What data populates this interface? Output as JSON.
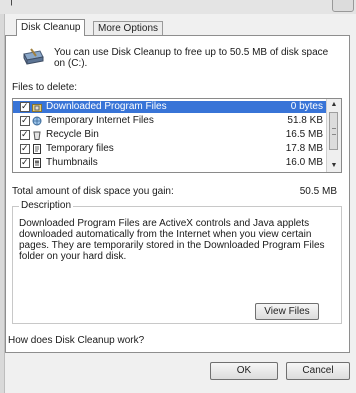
{
  "tabs": [
    {
      "label": "Disk Cleanup"
    },
    {
      "label": "More Options"
    }
  ],
  "intro": "You can use Disk Cleanup to free up to 50.5 MB of disk space on  (C:).",
  "files_label": "Files to delete:",
  "files": [
    {
      "name": "Downloaded Program Files",
      "size": "0 bytes",
      "checked": true,
      "selected": true,
      "icon": "folder-icon"
    },
    {
      "name": "Temporary Internet Files",
      "size": "51.8 KB",
      "checked": true,
      "selected": false,
      "icon": "internet-icon"
    },
    {
      "name": "Recycle Bin",
      "size": "16.5 MB",
      "checked": true,
      "selected": false,
      "icon": "recycle-bin-icon"
    },
    {
      "name": "Temporary files",
      "size": "17.8 MB",
      "checked": true,
      "selected": false,
      "icon": "document-icon"
    },
    {
      "name": "Thumbnails",
      "size": "16.0 MB",
      "checked": true,
      "selected": false,
      "icon": "thumbnail-icon"
    }
  ],
  "total": {
    "label": "Total amount of disk space you gain:",
    "value": "50.5 MB"
  },
  "description": {
    "legend": "Description",
    "text": "Downloaded Program Files are ActiveX controls and Java applets downloaded automatically from the Internet when you view certain pages. They are temporarily stored in the Downloaded Program Files folder on your hard disk."
  },
  "view_files_label": "View Files",
  "how_link": "How does Disk Cleanup work?",
  "ok_label": "OK",
  "cancel_label": "Cancel",
  "colors": {
    "selection": "#3874d7"
  }
}
